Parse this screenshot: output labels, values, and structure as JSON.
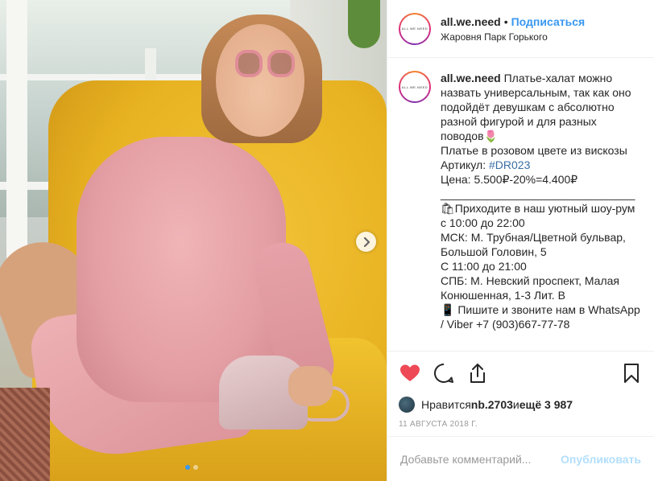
{
  "post": {
    "author": {
      "username": "all.we.need",
      "avatar_text": "ALL.WE.NEED",
      "bullet": "•",
      "follow_label": "Подписаться",
      "location": "Жаровня Парк Горького"
    },
    "caption": {
      "username": "all.we.need",
      "text_intro": " Платье-халат можно назвать универсальным, так как оно подойдёт девушкам с абсолютно разной фигурой и для разных поводов🌷\nПлатье в розовом цвете из вискозы\nАртикул: ",
      "hashtag": "#DR023",
      "text_rest": "\nЦена: 5.500₽-20%=4.400₽\n_______________________________\n🛍Приходите в наш уютный шоу-рум с 10:00 до 22:00\nМСК: М. Трубная/Цветной бульвар, Большой Головин, 5\nС 11:00 до 21:00\nСПБ: М. Невский проспект, Малая Конюшенная, 1-3 Лит. В\n📱 Пишите и звоните нам в WhatsApp / Viber +7 (903)667-77-78"
    },
    "likes": {
      "prefix": "Нравится ",
      "user": "nb.2703",
      "mid": " и ",
      "more": "ещё 3 987"
    },
    "date": "11 августа 2018 г.",
    "comment": {
      "placeholder": "Добавьте комментарий...",
      "publish_label": "Опубликовать"
    },
    "carousel": {
      "total": 2,
      "current": 1
    }
  },
  "icons": {
    "like": "heart-icon",
    "comment": "comment-icon",
    "share": "share-icon",
    "save": "bookmark-icon",
    "next": "chevron-right-icon"
  },
  "colors": {
    "link": "#3897f0",
    "like_red": "#ed4956",
    "publish_disabled": "#b2dffc"
  }
}
